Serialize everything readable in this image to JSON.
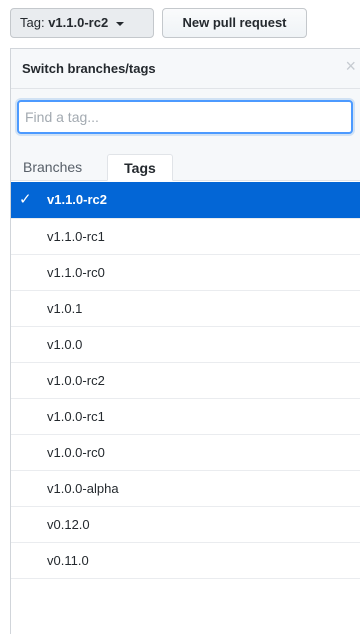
{
  "header": {
    "tag_prefix": "Tag:",
    "tag_value": "v1.1.0-rc2",
    "new_pr_label": "New pull request"
  },
  "dropdown": {
    "title": "Switch branches/tags",
    "close_glyph": "×",
    "search_placeholder": "Find a tag...",
    "tabs": [
      {
        "label": "Branches",
        "active": false
      },
      {
        "label": "Tags",
        "active": true
      }
    ],
    "selected_tag": "v1.1.0-rc2",
    "items": [
      {
        "label": "v1.1.0-rc2",
        "selected": true
      },
      {
        "label": "v1.1.0-rc1",
        "selected": false
      },
      {
        "label": "v1.1.0-rc0",
        "selected": false
      },
      {
        "label": "v1.0.1",
        "selected": false
      },
      {
        "label": "v1.0.0",
        "selected": false
      },
      {
        "label": "v1.0.0-rc2",
        "selected": false
      },
      {
        "label": "v1.0.0-rc1",
        "selected": false
      },
      {
        "label": "v1.0.0-rc0",
        "selected": false
      },
      {
        "label": "v1.0.0-alpha",
        "selected": false
      },
      {
        "label": "v0.12.0",
        "selected": false
      },
      {
        "label": "v0.11.0",
        "selected": false
      }
    ]
  },
  "colors": {
    "selected_bg": "#0366d6",
    "focus_border": "#4c9aff"
  },
  "icons": {
    "check": "check-icon",
    "close": "close-icon",
    "caret": "caret-down-icon"
  }
}
